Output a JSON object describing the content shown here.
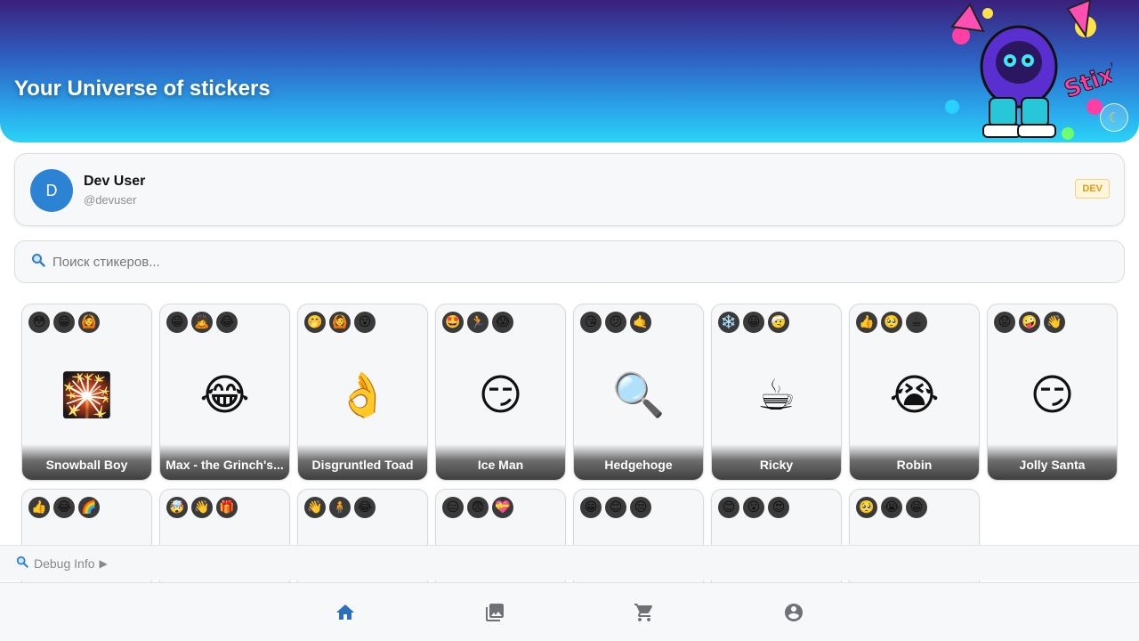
{
  "header": {
    "title": "Your Universe of stickers",
    "art_text": "Stixly",
    "theme_toggle_icon": "moon-icon"
  },
  "user": {
    "avatar_letter": "D",
    "name": "Dev User",
    "handle": "@devuser",
    "badge": "DEV"
  },
  "search": {
    "placeholder": "Поиск стикеров...",
    "icon": "search-icon"
  },
  "stickers": [
    {
      "name": "Snowball Boy",
      "emojis": [
        "😳",
        "😁",
        "🙆"
      ],
      "preview": "🎇"
    },
    {
      "name": "Max - the Grinch's...",
      "emojis": [
        "😁",
        "🙇",
        "😂"
      ],
      "preview": "😂"
    },
    {
      "name": "Disgruntled Toad",
      "emojis": [
        "🤭",
        "🙆",
        "😮"
      ],
      "preview": "👌"
    },
    {
      "name": "Ice Man",
      "emojis": [
        "🤩",
        "🏃",
        "😱"
      ],
      "preview": "😏"
    },
    {
      "name": "Hedgehoge",
      "emojis": [
        "😘",
        "😕",
        "🤙"
      ],
      "preview": "🔍"
    },
    {
      "name": "Ricky",
      "emojis": [
        "❄️",
        "😀",
        "🤕"
      ],
      "preview": "☕"
    },
    {
      "name": "Robin",
      "emojis": [
        "👍",
        "🥺",
        "☕"
      ],
      "preview": "😭"
    },
    {
      "name": "Jolly Santa",
      "emojis": [
        "😟",
        "🤪",
        "👋"
      ],
      "preview": "😏"
    },
    {
      "name": "",
      "emojis": [
        "👍",
        "😂",
        "🌈"
      ],
      "preview": ""
    },
    {
      "name": "",
      "emojis": [
        "🤯",
        "👋",
        "🎁"
      ],
      "preview": ""
    },
    {
      "name": "",
      "emojis": [
        "👋",
        "🧍",
        "😂"
      ],
      "preview": ""
    },
    {
      "name": "",
      "emojis": [
        "😑",
        "😨",
        "💝"
      ],
      "preview": ""
    },
    {
      "name": "",
      "emojis": [
        "😁",
        "😊",
        "😔"
      ],
      "preview": ""
    },
    {
      "name": "",
      "emojis": [
        "😊",
        "😮",
        "😍"
      ],
      "preview": ""
    },
    {
      "name": "",
      "emojis": [
        "🥺",
        "😭",
        "😁"
      ],
      "preview": ""
    }
  ],
  "debug": {
    "label": "Debug Info",
    "arrow": "▶"
  },
  "nav": [
    {
      "name": "home",
      "icon": "home-icon",
      "active": true
    },
    {
      "name": "gallery",
      "icon": "gallery-icon",
      "active": false
    },
    {
      "name": "cart",
      "icon": "cart-icon",
      "active": false
    },
    {
      "name": "profile",
      "icon": "profile-icon",
      "active": false
    }
  ],
  "colors": {
    "accent": "#2c83d4",
    "nav_active": "#2b6fbd",
    "nav_inactive": "#6e7177",
    "badge_text": "#e39a12"
  }
}
